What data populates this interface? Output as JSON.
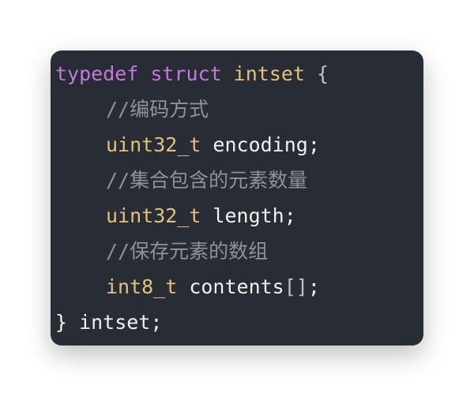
{
  "code": {
    "line1": {
      "kw1": "typedef",
      "kw2": "struct",
      "type": "intset",
      "brace": "{"
    },
    "line2": {
      "comment": "//编码方式"
    },
    "line3": {
      "type": "uint32_t",
      "name": "encoding",
      "semi": ";"
    },
    "line4": {
      "comment": "//集合包含的元素数量"
    },
    "line5": {
      "type": "uint32_t",
      "name": "length",
      "semi": ";"
    },
    "line6": {
      "comment": "//保存元素的数组"
    },
    "line7": {
      "type": "int8_t",
      "name": "contents",
      "brackets": "[]",
      "semi": ";"
    },
    "line8": {
      "brace": "}",
      "name": "intset",
      "semi": ";"
    }
  },
  "colors": {
    "background": "#282c34",
    "keyword": "#c678dd",
    "type": "#e5c07b",
    "identifier": "#f0f0f0",
    "comment": "#8d929b"
  }
}
